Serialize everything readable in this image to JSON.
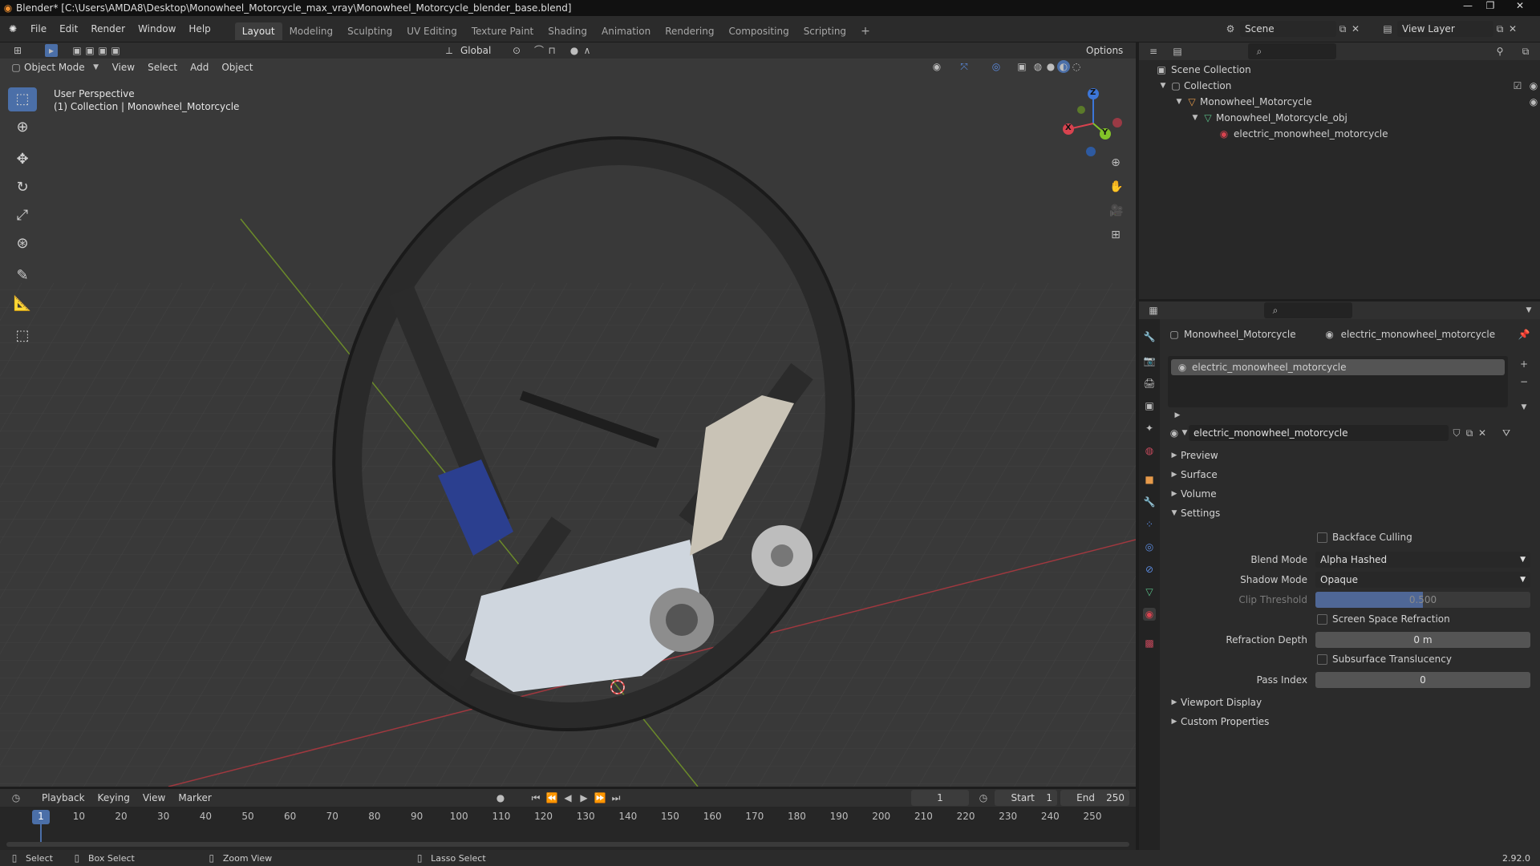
{
  "titlebar": {
    "app_icon": "blender-logo-icon",
    "title": "Blender* [C:\\Users\\AMDA8\\Desktop\\Monowheel_Motorcycle_max_vray\\Monowheel_Motorcycle_blender_base.blend]"
  },
  "menu": [
    "File",
    "Edit",
    "Render",
    "Window",
    "Help"
  ],
  "workspaces": [
    "Layout",
    "Modeling",
    "Sculpting",
    "UV Editing",
    "Texture Paint",
    "Shading",
    "Animation",
    "Rendering",
    "Compositing",
    "Scripting"
  ],
  "active_workspace": "Layout",
  "scene": {
    "label": "Scene",
    "view_layer": "View Layer"
  },
  "viewport": {
    "transform_orientation": "Global",
    "options_label": "Options",
    "mode": "Object Mode",
    "menus": [
      "View",
      "Select",
      "Add",
      "Object"
    ],
    "perspective": "User Perspective",
    "collection_info": "(1) Collection | Monowheel_Motorcycle",
    "gizmo": {
      "x": "X",
      "y": "Y",
      "z": "Z"
    }
  },
  "outliner": {
    "scene_collection": "Scene Collection",
    "items": [
      {
        "label": "Collection",
        "icon": "collection-icon"
      },
      {
        "label": "Monowheel_Motorcycle",
        "icon": "object-icon"
      },
      {
        "label": "Monowheel_Motorcycle_obj",
        "icon": "mesh-icon"
      },
      {
        "label": "electric_monowheel_motorcycle",
        "icon": "material-icon"
      }
    ]
  },
  "properties": {
    "breadcrumb_object": "Monowheel_Motorcycle",
    "breadcrumb_material": "electric_monowheel_motorcycle",
    "material_slot": "electric_monowheel_motorcycle",
    "material_name": "electric_monowheel_motorcycle",
    "panels": [
      "Preview",
      "Surface",
      "Volume",
      "Settings"
    ],
    "settings": {
      "backface_culling": "Backface Culling",
      "blend_mode_label": "Blend Mode",
      "blend_mode": "Alpha Hashed",
      "shadow_mode_label": "Shadow Mode",
      "shadow_mode": "Opaque",
      "clip_threshold_label": "Clip Threshold",
      "clip_threshold": "0.500",
      "clip_threshold_fraction": 0.5,
      "screen_space_refraction": "Screen Space Refraction",
      "refraction_depth_label": "Refraction Depth",
      "refraction_depth": "0 m",
      "subsurface_translucency": "Subsurface Translucency",
      "pass_index_label": "Pass Index",
      "pass_index": "0"
    },
    "panels_after": [
      "Viewport Display",
      "Custom Properties"
    ]
  },
  "timeline": {
    "menus": [
      "Playback",
      "Keying",
      "View",
      "Marker"
    ],
    "current_frame": "1",
    "start_label": "Start",
    "start": "1",
    "end_label": "End",
    "end": "250",
    "ticks": [
      1,
      10,
      20,
      30,
      40,
      50,
      60,
      70,
      80,
      90,
      100,
      110,
      120,
      130,
      140,
      150,
      160,
      170,
      180,
      190,
      200,
      210,
      220,
      230,
      240,
      250
    ]
  },
  "statusbar": {
    "select": "Select",
    "box_select": "Box Select",
    "zoom_view": "Zoom View",
    "lasso_select": "Lasso Select",
    "version": "2.92.0"
  }
}
